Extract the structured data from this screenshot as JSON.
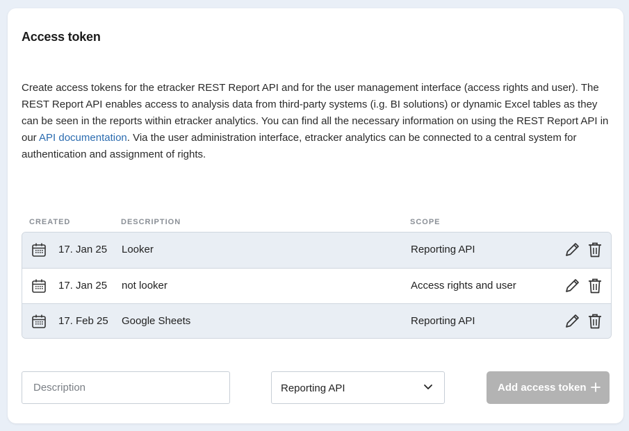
{
  "card": {
    "title": "Access token",
    "description": {
      "before_link": "Create access tokens for the etracker REST Report API and for the user management interface (access rights and user). The REST Report API enables access to analysis data from third-party systems (i.g. BI solutions) or dynamic Excel tables as they can be seen in the reports within etracker analytics. You can find all the necessary information on using the REST Report API in our ",
      "link_text": "API documentation",
      "after_link": ". Via the user administration interface, etracker analytics can be connected to a central system for authentication and assignment of rights."
    }
  },
  "table": {
    "headers": {
      "created": "CREATED",
      "description": "DESCRIPTION",
      "scope": "SCOPE"
    },
    "rows": [
      {
        "created": "17. Jan 25",
        "description": "Looker",
        "scope": "Reporting API"
      },
      {
        "created": "17. Jan 25",
        "description": "not looker",
        "scope": "Access rights and user"
      },
      {
        "created": "17. Feb 25",
        "description": "Google Sheets",
        "scope": "Reporting API"
      }
    ],
    "icons": {
      "created": "calendar-icon",
      "edit": "pencil-icon",
      "delete": "trash-icon"
    }
  },
  "form": {
    "description_placeholder": "Description",
    "description_value": "",
    "scope_selected": "Reporting API",
    "add_button_label": "Add access token"
  },
  "colors": {
    "link": "#2b6cb0",
    "row_highlight": "#e9eef4",
    "button_disabled": "#b3b3b3",
    "page_background": "#e9eff7"
  }
}
